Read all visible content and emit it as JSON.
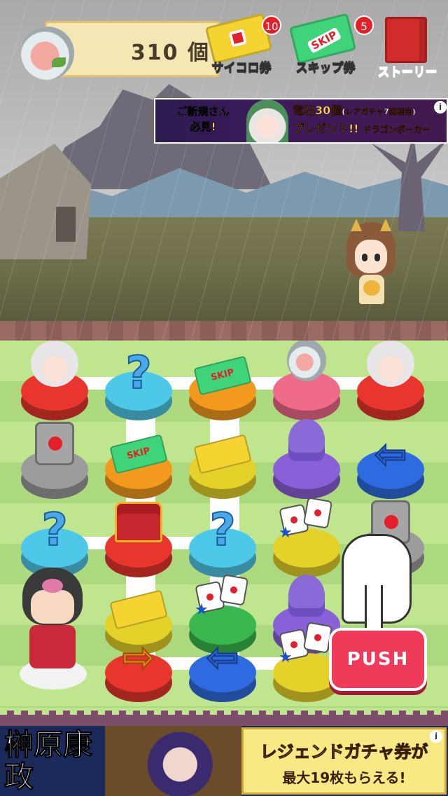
{
  "hud": {
    "coins": "310",
    "coins_unit": "個",
    "dice_ticket_label": "サイコロ券",
    "dice_ticket_count": "10",
    "skip_ticket_text": "SKIP",
    "skip_ticket_label": "スキップ券",
    "skip_ticket_count": "5",
    "story_label": "ストーリー"
  },
  "ad_top": {
    "left_line1": "ご新規さん",
    "left_line2": "必見!",
    "right_line1": "竜石30個",
    "right_small": "(レアガチャ7回相当)",
    "right_line2": "プレゼント!!",
    "brand": "ドラゴンポーカー",
    "info": "i"
  },
  "board": {
    "tile_question": "?",
    "skip": "SKIP",
    "arrow_left": "⇦",
    "arrow_right": "⇨"
  },
  "push_label": "PUSH",
  "ad_bottom": {
    "kanji": "榊原康政",
    "promo_line1": "レジェンドガチャ券が",
    "promo_line2": "最大19枚もらえる!",
    "info": "i"
  },
  "colors": {
    "push": "#f03a5a",
    "dice_ticket": "#f5d431",
    "skip_ticket": "#3fd47a",
    "story": "#d22b2b"
  }
}
